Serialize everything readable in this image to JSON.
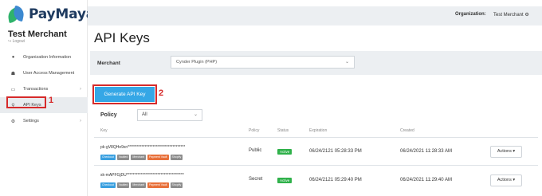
{
  "brand": {
    "name": "PayMaya"
  },
  "sidebar": {
    "merchant_name": "Test Merchant",
    "logout": "Logout",
    "items": [
      {
        "icon": "info-icon",
        "label": "Organization Information"
      },
      {
        "icon": "users-icon",
        "label": "User Access Management"
      },
      {
        "icon": "transactions-icon",
        "label": "Transactions"
      },
      {
        "icon": "key-icon",
        "label": "API Keys"
      },
      {
        "icon": "gear-icon",
        "label": "Settings"
      }
    ],
    "annotation": "1"
  },
  "topbar": {
    "org_label": "Organization:",
    "org_value": "Test Merchant"
  },
  "page": {
    "title": "API Keys"
  },
  "merchant": {
    "label": "Merchant",
    "selected": "Cynder Plugin (PHP)"
  },
  "generate": {
    "label": "Generate API Key",
    "annotation": "2"
  },
  "policy": {
    "label": "Policy",
    "selected": "All"
  },
  "table": {
    "headers": [
      "Key",
      "Policy",
      "Status",
      "Expiration",
      "Created"
    ],
    "rows": [
      {
        "key": "pk-gV8QHe9xn*************************************",
        "tags": [
          "Checkout",
          "Vaulted",
          "Merchant",
          "Payment Vault",
          "Shopify"
        ],
        "policy": "Public",
        "status": "Active",
        "expiration": "06/24/2121 05:28:33 PM",
        "created": "06/24/2021 11:28:33 AM",
        "action": "Actions ▾"
      },
      {
        "key": "sk-mAPFGjDU*************************************",
        "tags": [
          "Checkout",
          "Vaulted",
          "Merchant",
          "Payment Vault",
          "Shopify"
        ],
        "policy": "Secret",
        "status": "Active",
        "expiration": "06/24/2121 05:29:40 PM",
        "created": "06/24/2021 11:29:40 AM",
        "action": "Actions ▾"
      }
    ],
    "tag_colors": [
      "#3aa0e0",
      "#8c8c8c",
      "#8c8c8c",
      "#e8703a",
      "#8c8c8c"
    ]
  },
  "colors": {
    "accent": "#35a7e6",
    "annotation": "#d62a2a",
    "status_active": "#2fb14a"
  }
}
